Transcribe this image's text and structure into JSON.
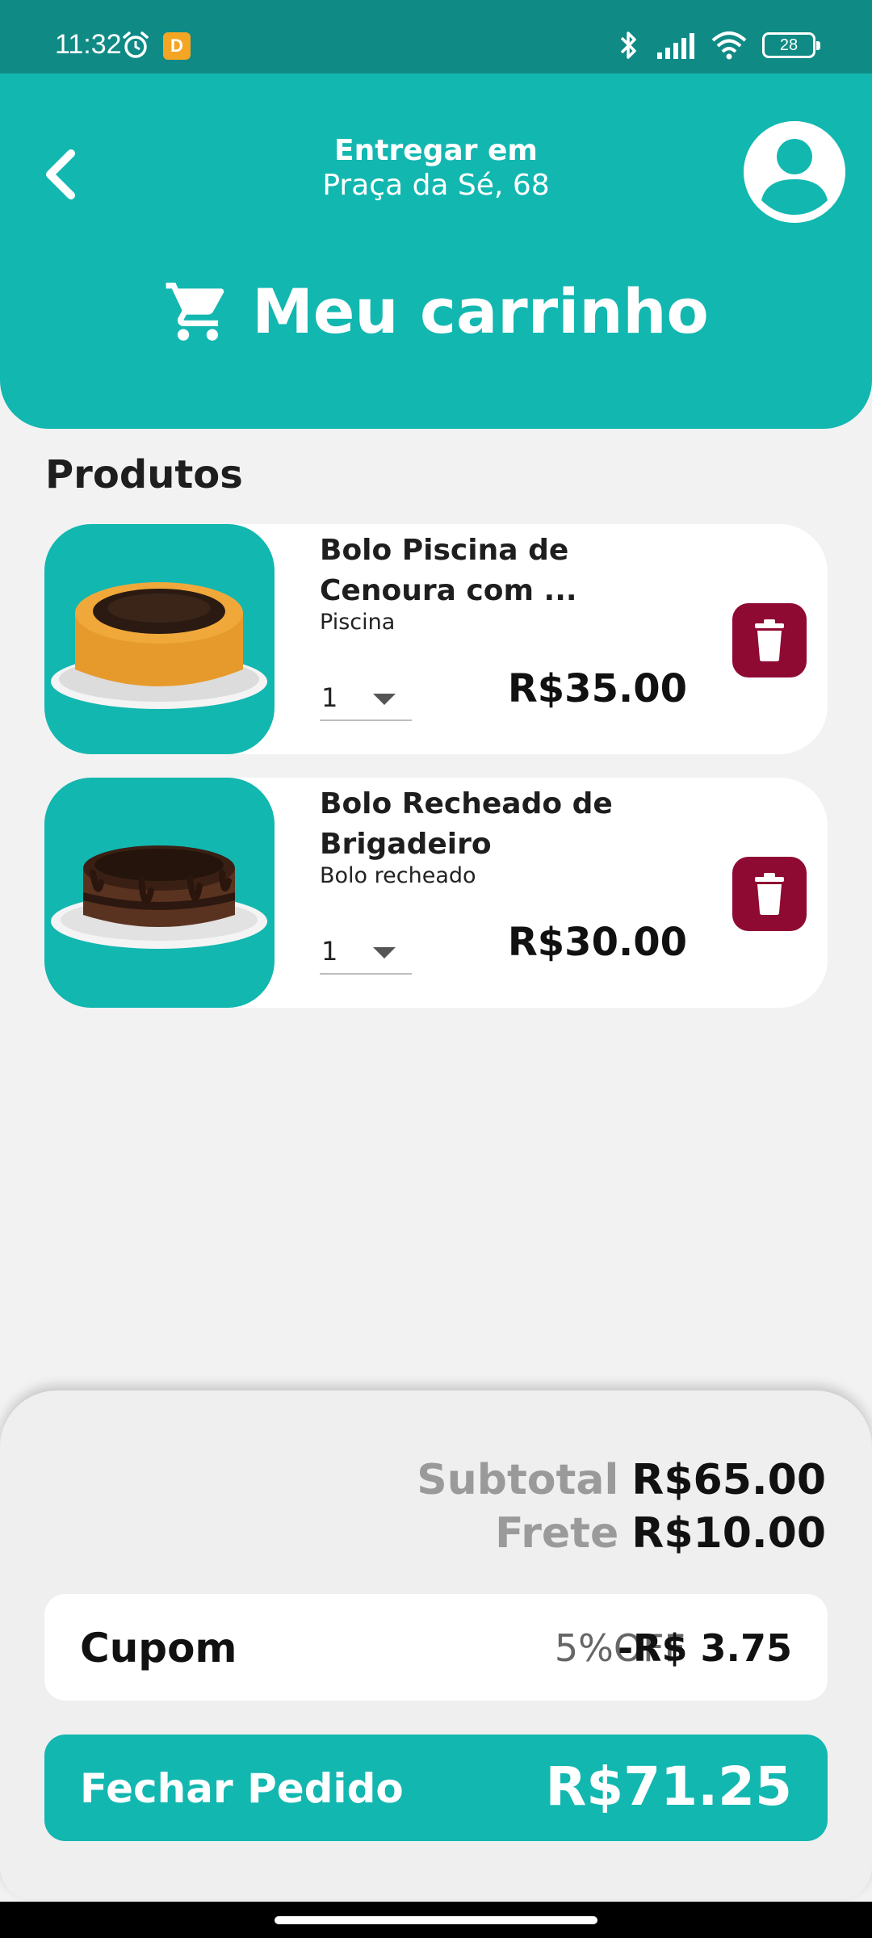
{
  "status_bar": {
    "time": "11:32",
    "app_badge": "D",
    "battery": "28"
  },
  "header": {
    "deliver_label": "Entregar em",
    "address": "Praça da Sé, 68",
    "title": "Meu carrinho"
  },
  "products": {
    "section_title": "Produtos",
    "items": [
      {
        "name": "Bolo Piscina de Cenoura com ...",
        "category": "Piscina",
        "quantity": "1",
        "price": "R$35.00"
      },
      {
        "name": "Bolo Recheado de Brigadeiro",
        "category": "Bolo recheado",
        "quantity": "1",
        "price": "R$30.00"
      }
    ]
  },
  "summary": {
    "subtotal_label": "Subtotal",
    "subtotal_value": "R$65.00",
    "shipping_label": "Frete",
    "shipping_value": "R$10.00",
    "coupon_label": "Cupom",
    "coupon_code": "5%OFF",
    "coupon_discount": "-R$ 3.75",
    "checkout_label": "Fechar Pedido",
    "total": "R$71.25"
  },
  "colors": {
    "primary": "#12b7b0",
    "status_bar": "#0f8a85",
    "delete": "#8f0a33",
    "background": "#f2f2f2"
  },
  "icons": [
    "alarm-icon",
    "bluetooth-icon",
    "signal-icon",
    "wifi-icon",
    "battery-icon",
    "back-arrow-icon",
    "user-avatar-icon",
    "cart-icon",
    "trash-icon",
    "dropdown-caret-icon"
  ]
}
